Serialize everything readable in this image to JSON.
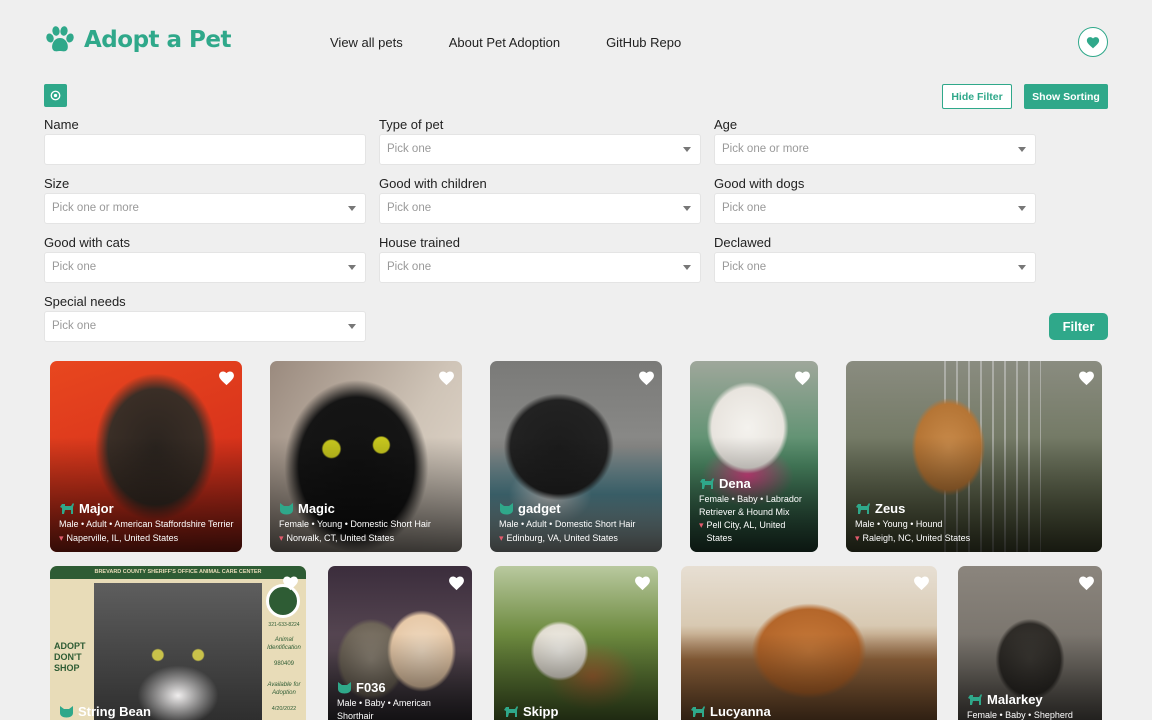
{
  "brand": {
    "title": "Adopt a Pet",
    "color": "#2fa88a"
  },
  "nav": [
    "View all pets",
    "About Pet Adoption",
    "GitHub Repo"
  ],
  "toolbar": {
    "hide_filter": "Hide Filter",
    "show_sorting": "Show Sorting"
  },
  "filters": [
    {
      "label": "Name",
      "value": "",
      "placeholder": ""
    },
    {
      "label": "Type of pet",
      "placeholder": "Pick one"
    },
    {
      "label": "Age",
      "placeholder": "Pick one or more"
    },
    {
      "label": "Size",
      "placeholder": "Pick one or more"
    },
    {
      "label": "Good with children",
      "placeholder": "Pick one"
    },
    {
      "label": "Good with dogs",
      "placeholder": "Pick one"
    },
    {
      "label": "Good with cats",
      "placeholder": "Pick one"
    },
    {
      "label": "House trained",
      "placeholder": "Pick one"
    },
    {
      "label": "Declawed",
      "placeholder": "Pick one"
    },
    {
      "label": "Special needs",
      "placeholder": "Pick one"
    }
  ],
  "filter_button": "Filter",
  "pets": [
    {
      "name": "Major",
      "kind": "dog",
      "meta": "Male • Adult • American Staffordshire Terrier",
      "location": "Naperville, IL, United States"
    },
    {
      "name": "Magic",
      "kind": "cat",
      "meta": "Female • Young • Domestic Short Hair",
      "location": "Norwalk, CT, United States"
    },
    {
      "name": "gadget",
      "kind": "cat",
      "meta": "Male • Adult • Domestic Short Hair",
      "location": "Edinburg, VA, United States"
    },
    {
      "name": "Dena",
      "kind": "dog",
      "meta": "Female • Baby • Labrador Retriever & Hound Mix",
      "location": "Pell City, AL, United States"
    },
    {
      "name": "Zeus",
      "kind": "dog",
      "meta": "Male • Young • Hound",
      "location": "Raleigh, NC, United States"
    },
    {
      "name": "String Bean",
      "kind": "cat",
      "meta": "",
      "location": ""
    },
    {
      "name": "F036",
      "kind": "cat",
      "meta": "Male • Baby • American Shorthair",
      "location": ""
    },
    {
      "name": "Skipp",
      "kind": "dog",
      "meta": "",
      "location": ""
    },
    {
      "name": "Lucyanna",
      "kind": "dog",
      "meta": "",
      "location": ""
    },
    {
      "name": "Malarkey",
      "kind": "dog",
      "meta": "Female • Baby • Shepherd",
      "location": ""
    }
  ],
  "poster": {
    "header": "BREVARD COUNTY SHERIFF'S OFFICE ANIMAL CARE CENTER",
    "left_text": "ADOPT DON'T SHOP",
    "phone": "321-633-8224",
    "id_label": "Animal Identification",
    "id_number": "980409",
    "avail_label": "Available for Adoption",
    "date": "4/20/2022"
  }
}
